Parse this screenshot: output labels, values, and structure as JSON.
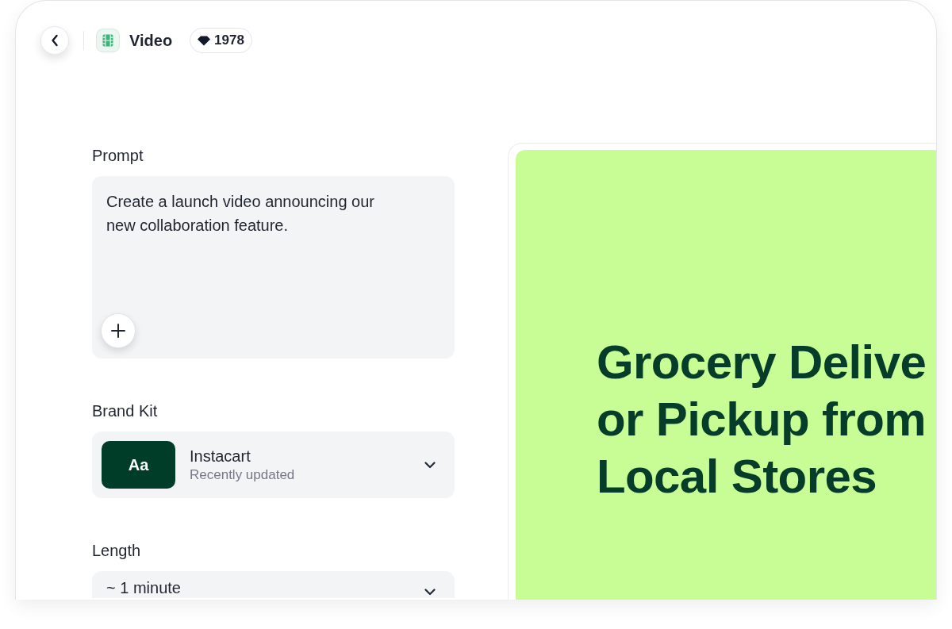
{
  "header": {
    "title": "Video",
    "credits": "1978"
  },
  "form": {
    "fields": [
      {
        "kind": "textarea",
        "label": "Prompt",
        "value": "Create a launch video announcing our new collaboration feature."
      },
      {
        "kind": "brand",
        "label": "Brand Kit",
        "swatch": "Aa",
        "name": "Instacart",
        "subtitle": "Recently updated"
      },
      {
        "kind": "select",
        "label": "Length",
        "value": "~ 1 minute"
      }
    ]
  },
  "preview": {
    "headline": [
      "Grocery Delive",
      "or Pickup from",
      "Local Stores"
    ]
  }
}
